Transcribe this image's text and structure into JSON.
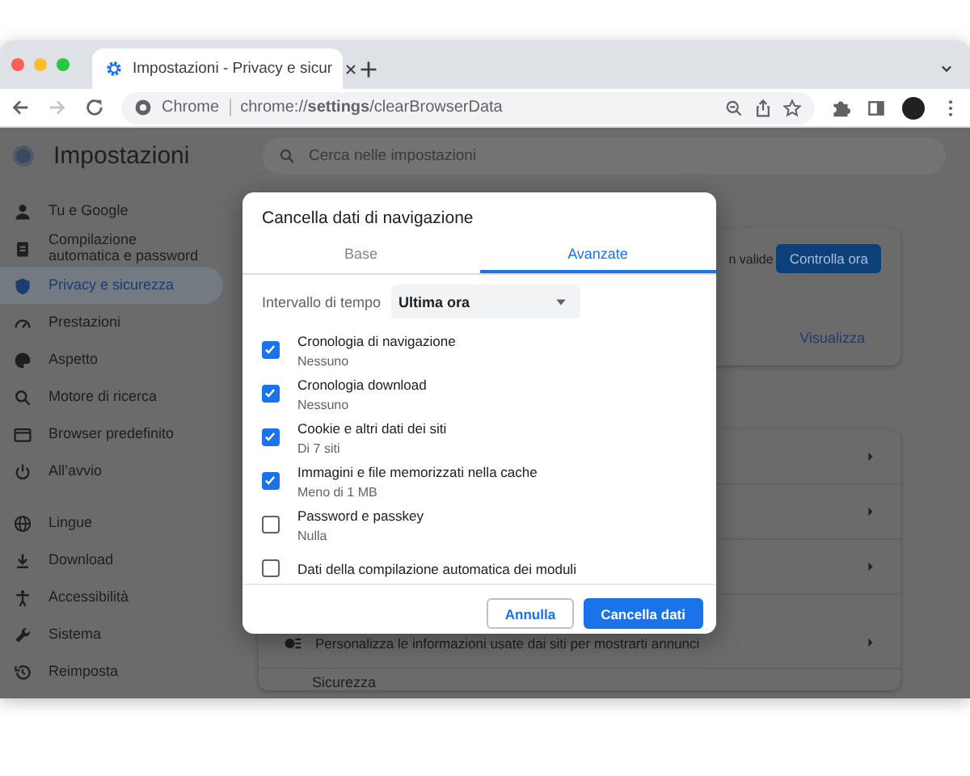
{
  "browser": {
    "tab": {
      "title": "Impostazioni - Privacy e sicur"
    },
    "nav_buttons": [
      {
        "kind": "back",
        "disabled": false
      },
      {
        "kind": "forward",
        "disabled": true
      },
      {
        "kind": "reload",
        "disabled": false
      }
    ],
    "omnibox": {
      "site_label": "Chrome",
      "url": "chrome://**settings**/clearBrowserData"
    }
  },
  "settings": {
    "title": "Impostazioni",
    "search": {
      "placeholder": "Cerca nelle impostazioni"
    },
    "sidebar": {
      "groups": [
        {
          "items": [
            {
              "label": "Tu e Google",
              "kind": "person",
              "selected": false
            },
            {
              "label": "Compilazione automatica e password",
              "kind": "clipboard",
              "selected": false
            },
            {
              "label": "Privacy e sicurezza",
              "kind": "shield",
              "selected": true
            },
            {
              "label": "Prestazioni",
              "kind": "gauge",
              "selected": false
            },
            {
              "label": "Aspetto",
              "kind": "palette",
              "selected": false
            },
            {
              "label": "Motore di ricerca",
              "kind": "search",
              "selected": false
            },
            {
              "label": "Browser predefinito",
              "kind": "window",
              "selected": false
            },
            {
              "label": "All’avvio",
              "kind": "power",
              "selected": false
            }
          ]
        },
        {
          "items": [
            {
              "label": "Lingue",
              "kind": "globe",
              "selected": false
            },
            {
              "label": "Download",
              "kind": "download",
              "selected": false
            },
            {
              "label": "Accessibilità",
              "kind": "accessibility",
              "selected": false
            },
            {
              "label": "Sistema",
              "kind": "wrench",
              "selected": false
            },
            {
              "label": "Reimposta",
              "kind": "history",
              "selected": false
            }
          ]
        }
      ]
    },
    "safety_card": {
      "partial_text": "n valide",
      "check_button": "Controlla ora",
      "view_link": "Visualizza"
    },
    "privacy_rows": [
      {
        "text": null
      },
      {
        "text": null
      },
      {
        "text": null
      },
      {
        "text": "Personalizza le informazioni usate dai siti per mostrarti annunci"
      }
    ],
    "section_heading": "Sicurezza"
  },
  "dialog": {
    "title": "Cancella dati di navigazione",
    "tabs": [
      {
        "label": "Base",
        "selected": false
      },
      {
        "label": "Avanzate",
        "selected": true
      }
    ],
    "time_range": {
      "label": "Intervallo di tempo",
      "value": "Ultima ora"
    },
    "items": [
      {
        "label": "Cronologia di navigazione",
        "detail": "Nessuno",
        "checked": true
      },
      {
        "label": "Cronologia download",
        "detail": "Nessuno",
        "checked": true
      },
      {
        "label": "Cookie e altri dati dei siti",
        "detail": "Di 7 siti",
        "checked": true
      },
      {
        "label": "Immagini e file memorizzati nella cache",
        "detail": "Meno di 1 MB",
        "checked": true
      },
      {
        "label": "Password e passkey",
        "detail": "Nulla",
        "checked": false
      },
      {
        "label": "Dati della compilazione automatica dei moduli",
        "checked": false
      }
    ],
    "buttons": [
      {
        "label": "Annulla",
        "kind": "secondary"
      },
      {
        "label": "Cancella dati",
        "kind": "primary"
      }
    ]
  }
}
